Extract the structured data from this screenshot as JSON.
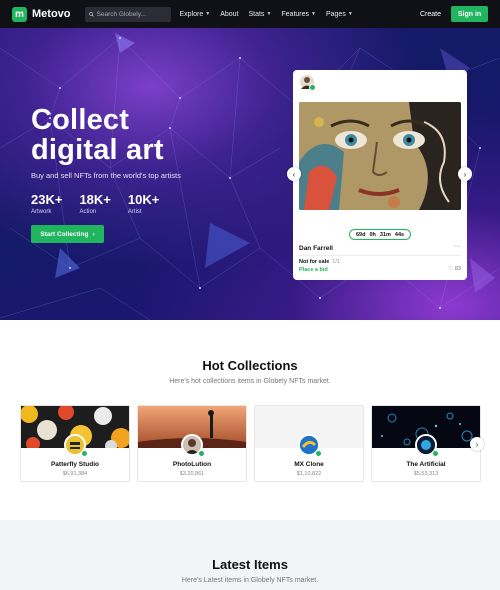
{
  "nav": {
    "logo": "Metovo",
    "logo_mark": "m",
    "search_placeholder": "Search Globely...",
    "menu": [
      {
        "label": "Explore",
        "dropdown": true
      },
      {
        "label": "About",
        "dropdown": false
      },
      {
        "label": "Stats",
        "dropdown": true
      },
      {
        "label": "Features",
        "dropdown": true
      },
      {
        "label": "Pages",
        "dropdown": true
      }
    ],
    "create": "Create",
    "signin": "Sign in"
  },
  "hero": {
    "title_line1": "Collect",
    "title_line2": "digital art",
    "subtitle": "Buy and sell NFTs from the world's top artists",
    "stats": [
      {
        "value": "23K+",
        "label": "Artwork"
      },
      {
        "value": "18K+",
        "label": "Action"
      },
      {
        "value": "10K+",
        "label": "Artist"
      }
    ],
    "cta": "Start Collecting"
  },
  "card": {
    "timer": [
      "69d",
      "0h",
      "31m",
      "44s"
    ],
    "name": "Dan Farrell",
    "status": "Not for sale",
    "status_extra": "1/1",
    "bid": "Place a bid",
    "likes": "83"
  },
  "hot": {
    "title": "Hot Collections",
    "subtitle": "Here's hot collections items in Globely NFTs market.",
    "items": [
      {
        "name": "Patterfly Studio",
        "code": "$6,91,384"
      },
      {
        "name": "PhotoLution",
        "code": "$3,20,861"
      },
      {
        "name": "MX Clone",
        "code": "$1,10,822"
      },
      {
        "name": "The Artificial",
        "code": "$5,53,313"
      }
    ]
  },
  "latest": {
    "title": "Latest Items",
    "subtitle": "Here's Latest items in Globely NFTs market."
  },
  "colors": {
    "accent": "#22b55f",
    "nav_bg": "#0f1117",
    "hero_bg": "#1a1a6e"
  }
}
